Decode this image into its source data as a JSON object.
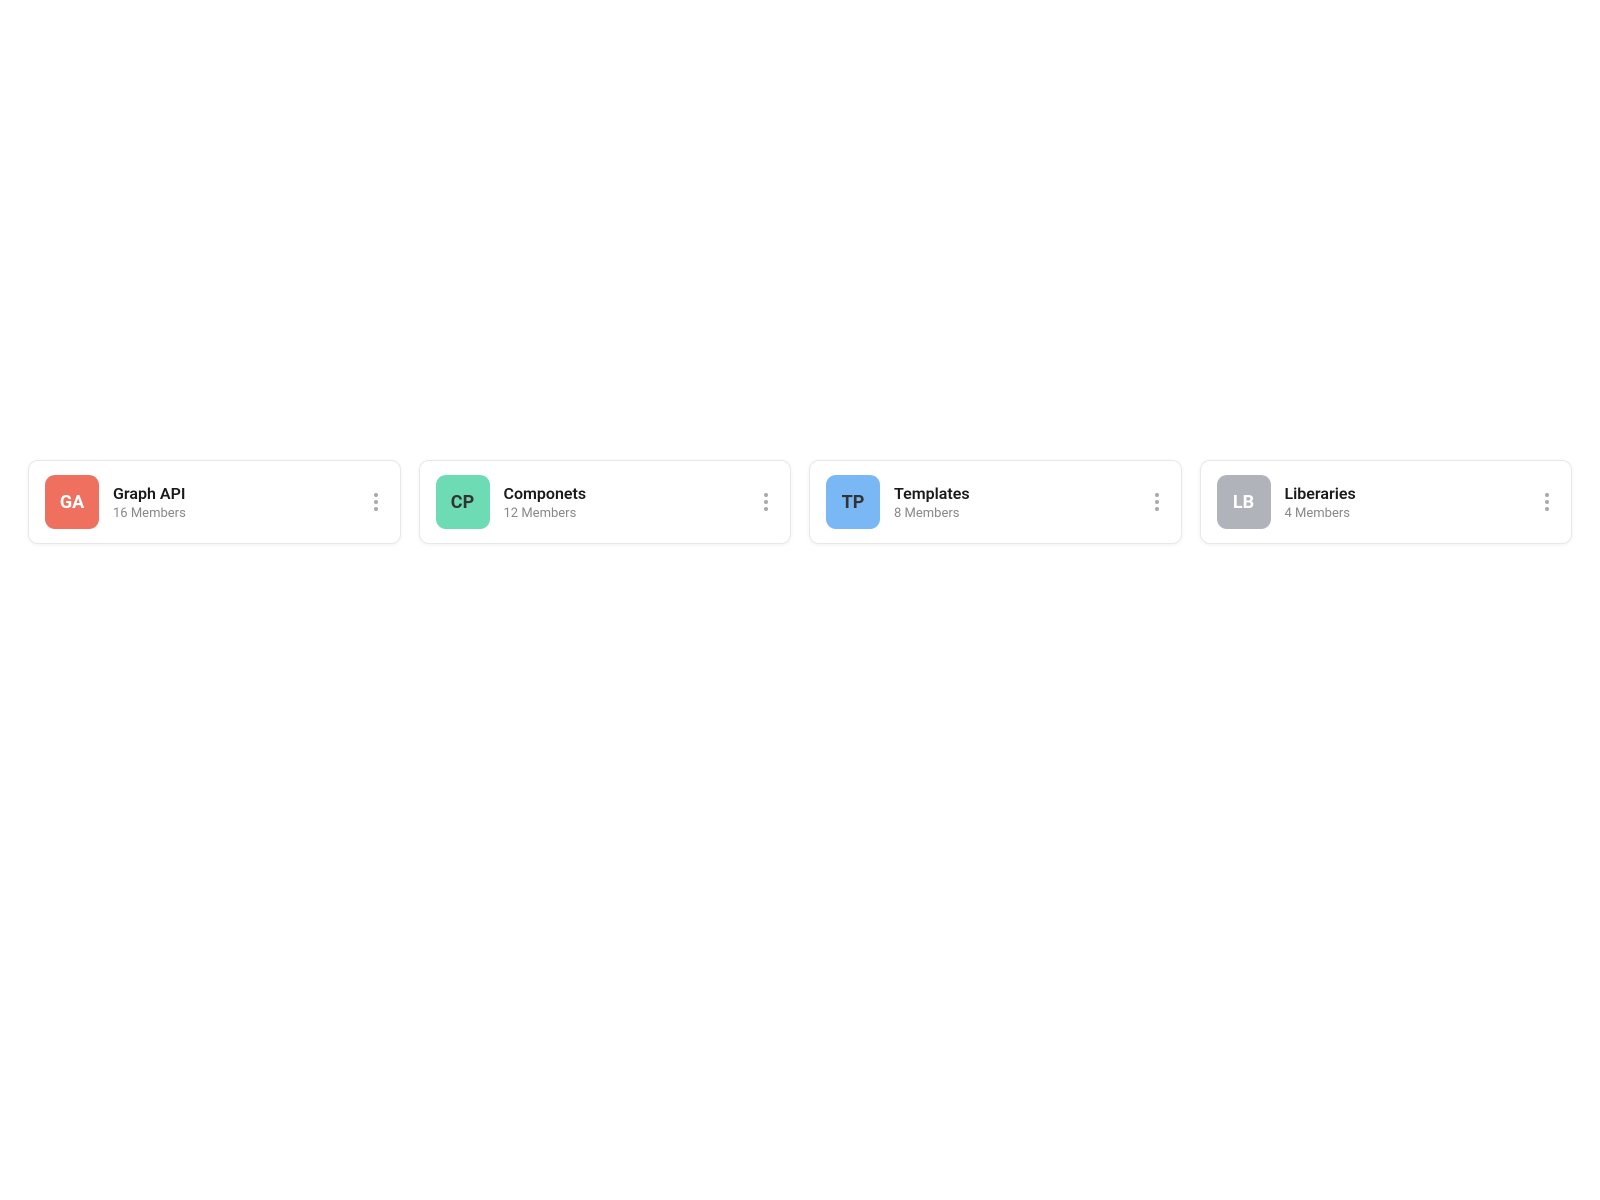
{
  "cards": [
    {
      "id": "graph-api",
      "avatar_text": "GA",
      "avatar_color_class": "avatar-red",
      "title": "Graph API",
      "subtitle": "16 Members"
    },
    {
      "id": "componets",
      "avatar_text": "CP",
      "avatar_color_class": "avatar-green",
      "title": "Componets",
      "subtitle": "12 Members"
    },
    {
      "id": "templates",
      "avatar_text": "TP",
      "avatar_color_class": "avatar-blue",
      "title": "Templates",
      "subtitle": "8 Members"
    },
    {
      "id": "liberaries",
      "avatar_text": "LB",
      "avatar_color_class": "avatar-gray",
      "title": "Liberaries",
      "subtitle": "4 Members"
    }
  ]
}
